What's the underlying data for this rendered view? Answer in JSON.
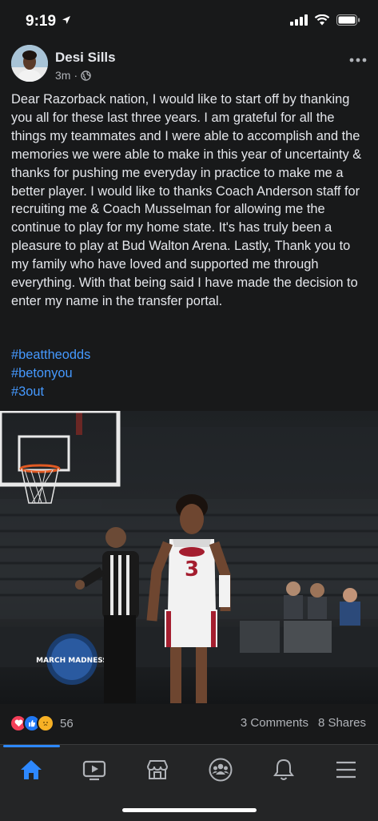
{
  "status_bar": {
    "time": "9:19"
  },
  "post": {
    "author": "Desi Sills",
    "time_ago": "3m",
    "body": "Dear Razorback nation, I would like to start off by thanking you all for these last three years. I am grateful for all the things my teammates and I were able to accomplish and the memories we were able to make in this year of uncertainty & thanks for pushing me everyday in practice to make me a better player. I would like to thanks Coach Anderson staff for recruiting me & Coach Musselman for allowing me the continue to play for my home state. It's has truly been a pleasure to play at Bud Walton Arena. Lastly, Thank you to my family who have loved and supported me through everything. With that being said I have made the decision to enter my name in the transfer portal.",
    "hashtags": [
      "#beattheodds",
      "#betonyou",
      "#3out"
    ],
    "photo": {
      "jersey_letters": "Arkansas",
      "jersey_number": "3",
      "banner_text": "MARCH MADNESS"
    }
  },
  "engagement": {
    "reaction_count": "56",
    "comments": "3 Comments",
    "shares": "8 Shares"
  },
  "tabs": [
    {
      "name": "home",
      "active": true
    },
    {
      "name": "watch",
      "active": false
    },
    {
      "name": "marketplace",
      "active": false
    },
    {
      "name": "groups",
      "active": false
    },
    {
      "name": "notifications",
      "active": false
    },
    {
      "name": "menu",
      "active": false
    }
  ],
  "colors": {
    "accent": "#2d88ff",
    "hashtag": "#4599ff",
    "background": "#18191a",
    "love": "#f33e58",
    "like": "#2078f4",
    "care": "#f7b125"
  }
}
